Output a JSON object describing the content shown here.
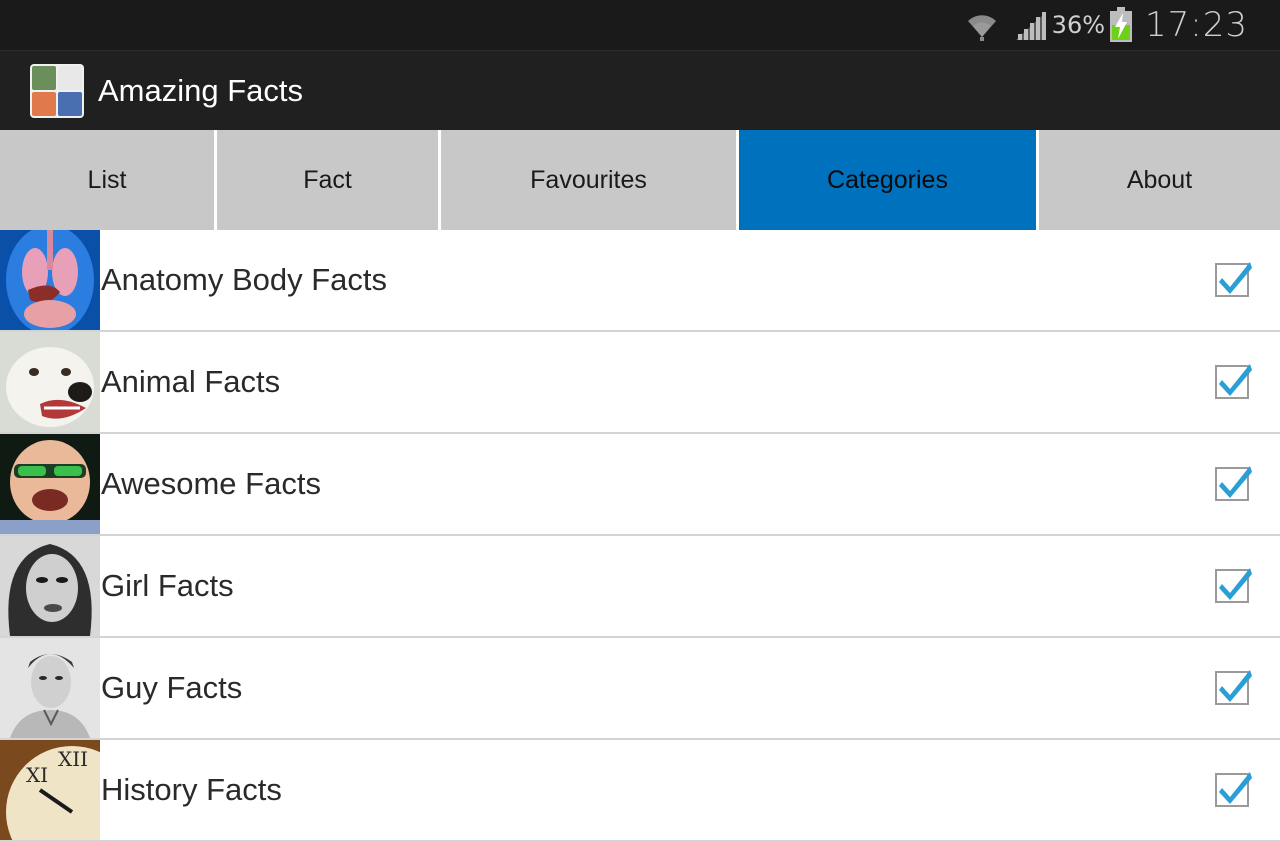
{
  "status_bar": {
    "battery_percent": "36%",
    "time": "17:23",
    "icons": [
      "wifi-icon",
      "signal-icon",
      "battery-charging-icon"
    ]
  },
  "action_bar": {
    "title": "Amazing Facts",
    "icon": "app-logo-icon"
  },
  "tabs": [
    {
      "label": "List",
      "active": false
    },
    {
      "label": "Fact",
      "active": false
    },
    {
      "label": "Favourites",
      "active": false
    },
    {
      "label": "Categories",
      "active": true
    },
    {
      "label": "About",
      "active": false
    }
  ],
  "colors": {
    "active_tab": "#0071bd",
    "tab_bg": "#c8c8c8",
    "checkbox_check": "#2a9fd6"
  },
  "categories": [
    {
      "label": "Anatomy Body Facts",
      "checked": true,
      "thumb": "anatomy-thumbnail"
    },
    {
      "label": "Animal Facts",
      "checked": true,
      "thumb": "dog-thumbnail"
    },
    {
      "label": "Awesome Facts",
      "checked": true,
      "thumb": "man-sunglasses-thumbnail"
    },
    {
      "label": "Girl Facts",
      "checked": true,
      "thumb": "woman-sketch-thumbnail"
    },
    {
      "label": "Guy Facts",
      "checked": true,
      "thumb": "man-sketch-thumbnail"
    },
    {
      "label": "History Facts",
      "checked": true,
      "thumb": "clock-thumbnail"
    }
  ]
}
